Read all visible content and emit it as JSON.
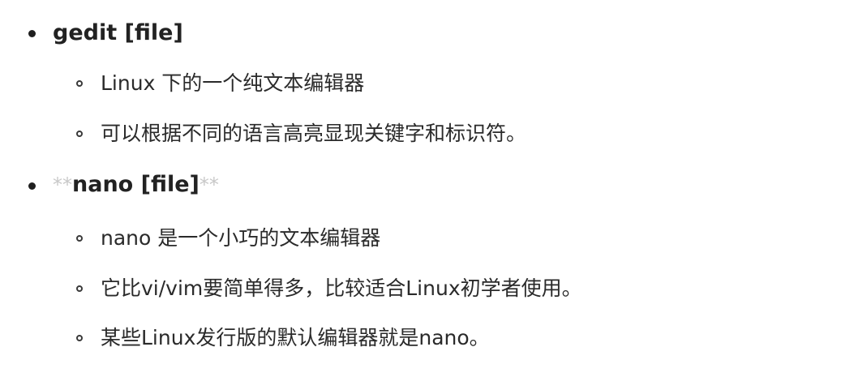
{
  "items": [
    {
      "label": "gedit [file]",
      "subitems": [
        "Linux 下的一个纯文本编辑器",
        "可以根据不同的语言高亮显现关键字和标识符。"
      ]
    },
    {
      "prefix_marks": "**",
      "label": "nano [file]",
      "suffix_marks": "**",
      "subitems": [
        "nano 是一个小巧的文本编辑器",
        "它比vi/vim要简单得多，比较适合Linux初学者使用。",
        "某些Linux发行版的默认编辑器就是nano。"
      ]
    }
  ]
}
